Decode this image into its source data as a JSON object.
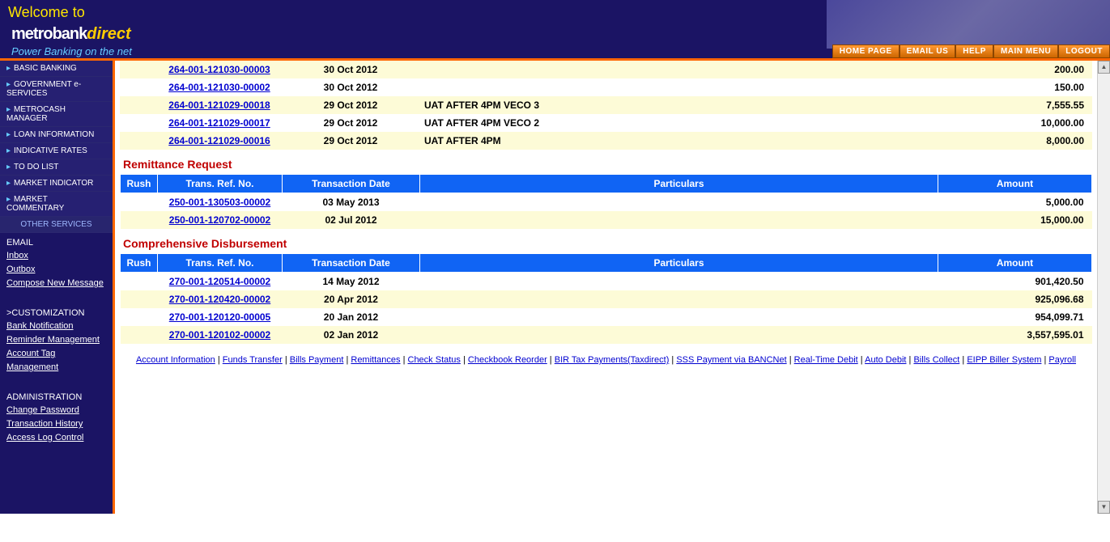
{
  "header": {
    "welcome": "Welcome to",
    "logo_main": "metrobank",
    "logo_sub": "direct",
    "tagline": "Power Banking on the net"
  },
  "topnav": {
    "home": "HOME PAGE",
    "email": "EMAIL US",
    "help": "HELP",
    "menu": "MAIN MENU",
    "logout": "LOGOUT"
  },
  "sidebar": {
    "items": [
      "BASIC BANKING",
      "GOVERNMENT e-SERVICES",
      "METROCASH MANAGER",
      "LOAN INFORMATION",
      "INDICATIVE RATES",
      "TO DO LIST",
      "MARKET INDICATOR",
      "MARKET COMMENTARY"
    ],
    "other": "OTHER SERVICES",
    "email_head": "EMAIL",
    "email_links": [
      "Inbox",
      "Outbox",
      "Compose New Message"
    ],
    "custom_head": ">CUSTOMIZATION",
    "custom_links": [
      "Bank Notification",
      "Reminder Management",
      "Account Tag Management"
    ],
    "admin_head": "ADMINISTRATION",
    "admin_links": [
      "Change Password",
      "Transaction History",
      "Access Log Control"
    ]
  },
  "columns": {
    "rush": "Rush",
    "ref": "Trans. Ref. No.",
    "date": "Transaction Date",
    "part": "Particulars",
    "amt": "Amount"
  },
  "sections": {
    "top_rows": [
      {
        "ref": "264-001-121030-00003",
        "date": "30 Oct 2012",
        "part": "",
        "amt": "200.00"
      },
      {
        "ref": "264-001-121030-00002",
        "date": "30 Oct 2012",
        "part": "",
        "amt": "150.00"
      },
      {
        "ref": "264-001-121029-00018",
        "date": "29 Oct 2012",
        "part": "UAT AFTER 4PM VECO 3",
        "amt": "7,555.55"
      },
      {
        "ref": "264-001-121029-00017",
        "date": "29 Oct 2012",
        "part": "UAT AFTER 4PM VECO 2",
        "amt": "10,000.00"
      },
      {
        "ref": "264-001-121029-00016",
        "date": "29 Oct 2012",
        "part": "UAT AFTER 4PM",
        "amt": "8,000.00"
      }
    ],
    "remit_title": "Remittance Request",
    "remit_rows": [
      {
        "ref": "250-001-130503-00002",
        "date": "03 May 2013",
        "part": "",
        "amt": "5,000.00"
      },
      {
        "ref": "250-001-120702-00002",
        "date": "02 Jul 2012",
        "part": "",
        "amt": "15,000.00"
      }
    ],
    "comp_title": "Comprehensive Disbursement",
    "comp_rows": [
      {
        "ref": "270-001-120514-00002",
        "date": "14 May 2012",
        "part": "",
        "amt": "901,420.50"
      },
      {
        "ref": "270-001-120420-00002",
        "date": "20 Apr 2012",
        "part": "",
        "amt": "925,096.68"
      },
      {
        "ref": "270-001-120120-00005",
        "date": "20 Jan 2012",
        "part": "",
        "amt": "954,099.71"
      },
      {
        "ref": "270-001-120102-00002",
        "date": "02 Jan 2012",
        "part": "",
        "amt": "3,557,595.01"
      }
    ]
  },
  "footer": {
    "links": [
      "Account Information",
      "Funds Transfer",
      "Bills Payment",
      "Remittances",
      "Check Status",
      "Checkbook Reorder",
      "BIR Tax Payments(Taxdirect)",
      "SSS Payment via BANCNet",
      "Real-Time Debit",
      "Auto Debit",
      "Bills Collect",
      "EIPP Biller System",
      "Payroll"
    ]
  }
}
